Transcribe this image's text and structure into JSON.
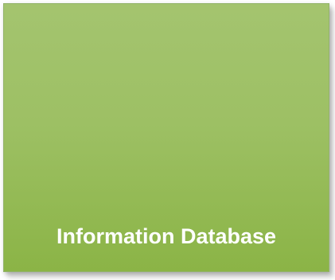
{
  "tile": {
    "label": "Information Database",
    "color": "#9dc064",
    "text_color": "#ffffff"
  }
}
